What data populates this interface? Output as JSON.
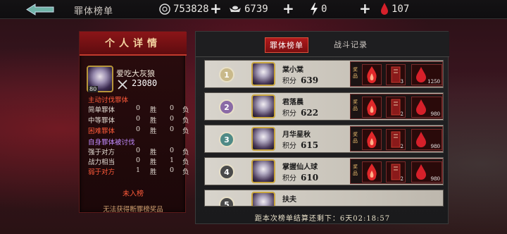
{
  "header": {
    "title": "罪体榜单"
  },
  "resources": [
    {
      "icon": "coin-icon",
      "value": "753828"
    },
    {
      "icon": "ingot-icon",
      "value": "6739"
    },
    {
      "icon": "lightning-icon",
      "value": "0"
    },
    {
      "icon": "blood-drop-icon",
      "value": "107"
    }
  ],
  "personal": {
    "title": "个人详情",
    "name": "爱吃大灰狼",
    "level": "80",
    "score": "23080",
    "attack_section": "主动讨伐罪体",
    "attack_rows": [
      {
        "label": "简单罪体",
        "win": "0",
        "win_label": "胜",
        "lose": "0",
        "lose_label": "负"
      },
      {
        "label": "中等罪体",
        "win": "0",
        "win_label": "胜",
        "lose": "0",
        "lose_label": "负"
      },
      {
        "label": "困难罪体",
        "win": "0",
        "win_label": "胜",
        "lose": "0",
        "lose_label": "负"
      }
    ],
    "defend_section": "自身罪体被讨伐",
    "defend_rows": [
      {
        "label": "强于对方",
        "win": "0",
        "win_label": "胜",
        "lose": "0",
        "lose_label": "负"
      },
      {
        "label": "战力相当",
        "win": "0",
        "win_label": "胜",
        "lose": "1",
        "lose_label": "负"
      },
      {
        "label": "弱于对方",
        "win": "1",
        "win_label": "胜",
        "lose": "0",
        "lose_label": "负"
      }
    ],
    "rank_status": "未入榜",
    "reward_note": "无法获得断罪榜奖品"
  },
  "tabs": [
    {
      "label": "罪体榜单",
      "active": true
    },
    {
      "label": "战斗记录",
      "active": false
    }
  ],
  "ranking": [
    {
      "rank": "1",
      "name": "棠小棠",
      "score_label": "积分",
      "score": "639",
      "level": "60",
      "reward_label": "奖品",
      "rewards": [
        {
          "count": ""
        },
        {
          "count": "3"
        },
        {
          "count": "1250"
        }
      ]
    },
    {
      "rank": "2",
      "name": "君落晨",
      "score_label": "积分",
      "score": "622",
      "level": "",
      "reward_label": "奖品",
      "rewards": [
        {
          "count": ""
        },
        {
          "count": "2"
        },
        {
          "count": "980"
        }
      ]
    },
    {
      "rank": "3",
      "name": "月华星秋",
      "score_label": "积分",
      "score": "615",
      "level": "",
      "reward_label": "奖品",
      "rewards": [
        {
          "count": ""
        },
        {
          "count": "2"
        },
        {
          "count": "980"
        }
      ]
    },
    {
      "rank": "4",
      "name": "掌握仙人球",
      "score_label": "积分",
      "score": "610",
      "level": "",
      "reward_label": "奖品",
      "rewards": [
        {
          "count": ""
        },
        {
          "count": "2"
        },
        {
          "count": "980"
        }
      ]
    },
    {
      "rank": "5",
      "name": "扶夫",
      "score_label": "积分",
      "score": "",
      "level": "",
      "reward_label": "",
      "rewards": []
    }
  ],
  "timer": {
    "prefix": "距本次榜单结算还剩下：",
    "value": "6天02:18:57"
  },
  "colors": {
    "accent_red": "#b01a1c",
    "highlight_red": "#ff5a3a",
    "gold": "#c9a640",
    "purple": "#c28cff"
  }
}
